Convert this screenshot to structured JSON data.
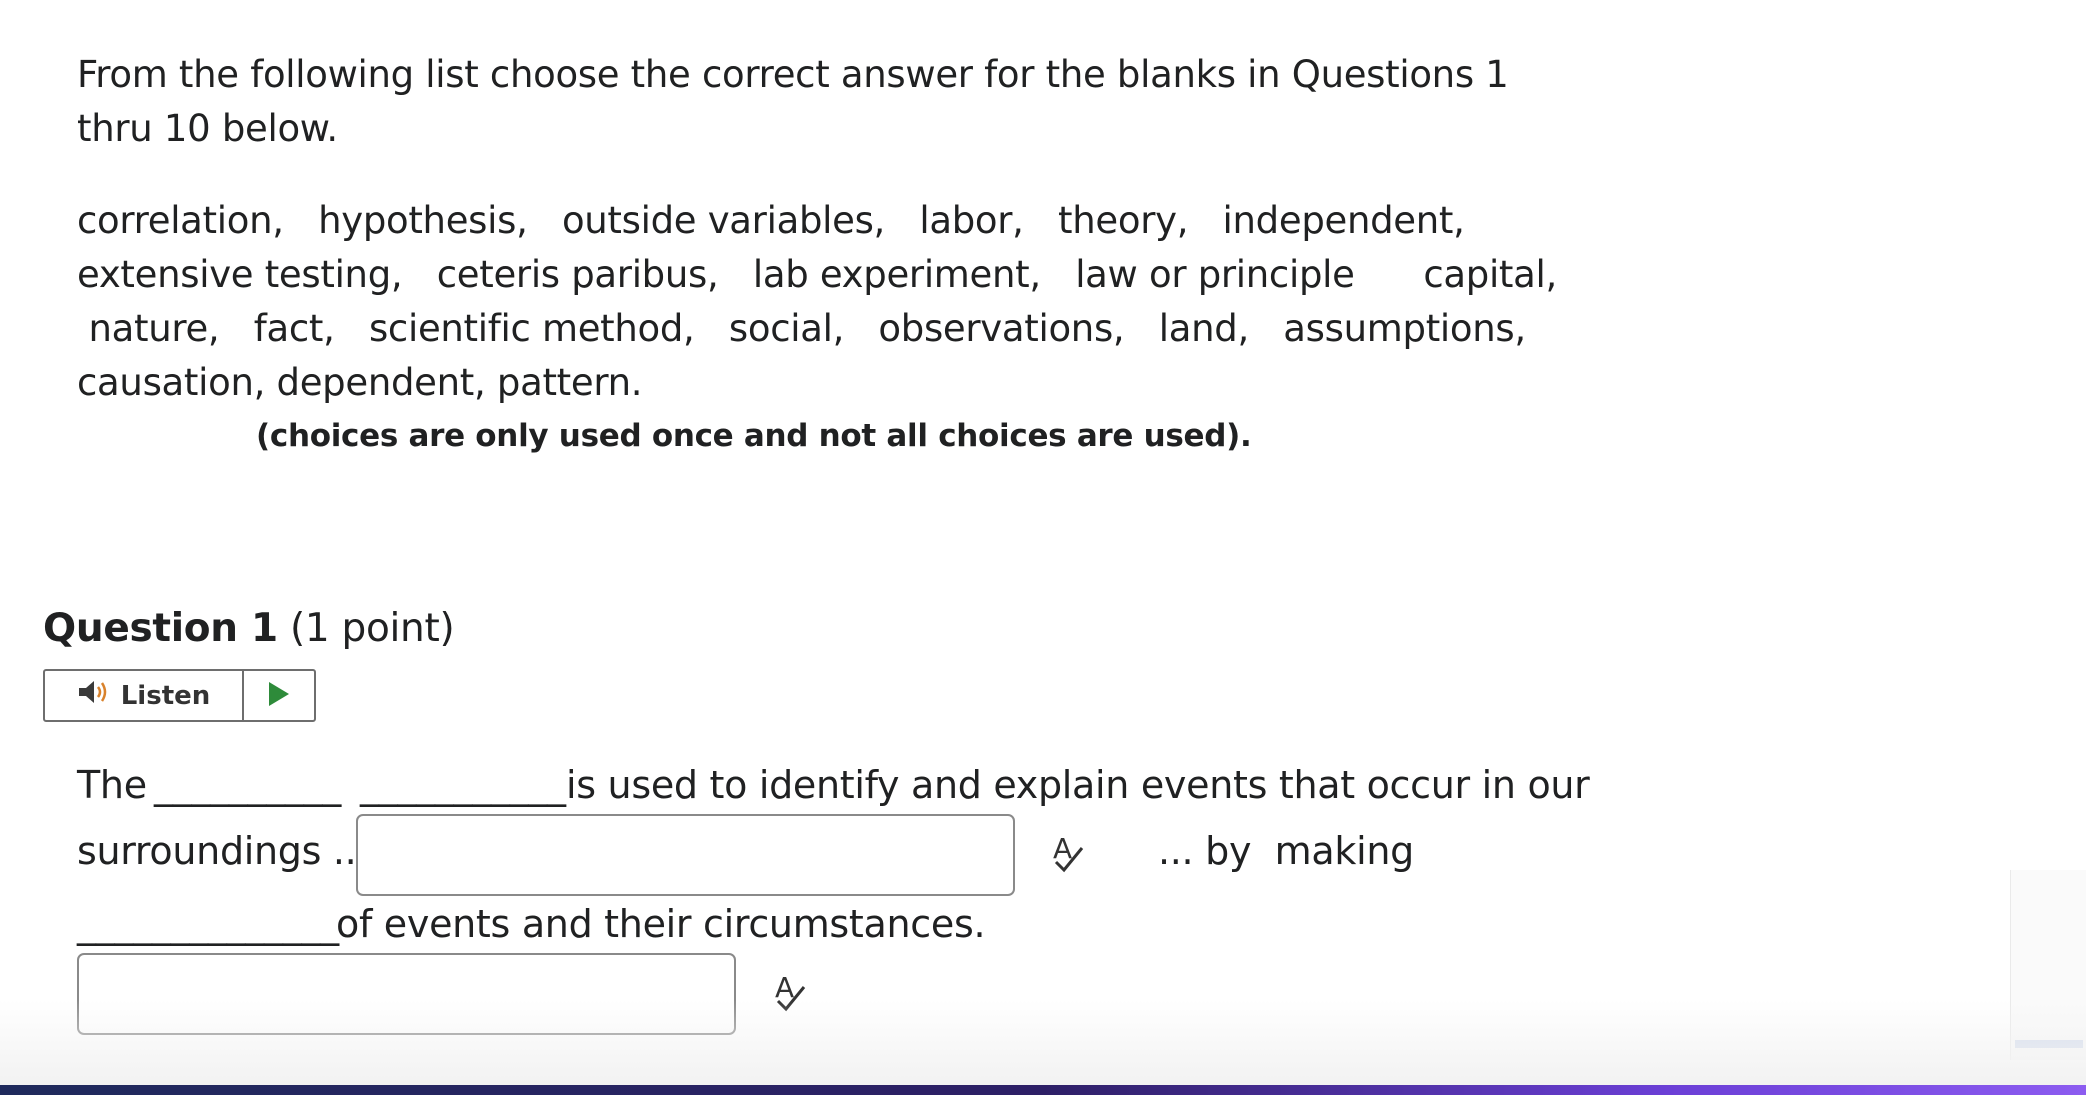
{
  "instructions": {
    "text": "From the following list choose the correct answer for the blanks in Questions 1 thru 10 below."
  },
  "word_list": {
    "lines": [
      "correlation,   hypothesis,   outside variables,   labor,   theory,   independent,",
      "extensive testing,   ceteris paribus,   lab experiment,   law or principle      capital,",
      " nature,   fact,   scientific method,   social,   observations,   land,   assumptions,",
      "causation, dependent, pattern."
    ],
    "note": "(choices are only used once and not all choices are used)."
  },
  "question": {
    "name": "Question 1",
    "points": "(1 point)",
    "listen_label": "Listen",
    "text_the": "The",
    "blank_a": "__________",
    "blank_b": "___________",
    "text_after_blanks": "is used to identify and explain events that occur in our",
    "text_surroundings": "surroundings ...",
    "text_by_making": "... by  making",
    "blank_c": "______________",
    "text_of_events": "of events and their circumstances.",
    "answer_1_value": "",
    "answer_2_value": ""
  },
  "colors": {
    "play_green": "#2e8b3a",
    "speaker_icon": "#3a3a3a",
    "speaker_waves": "#d9822b"
  }
}
